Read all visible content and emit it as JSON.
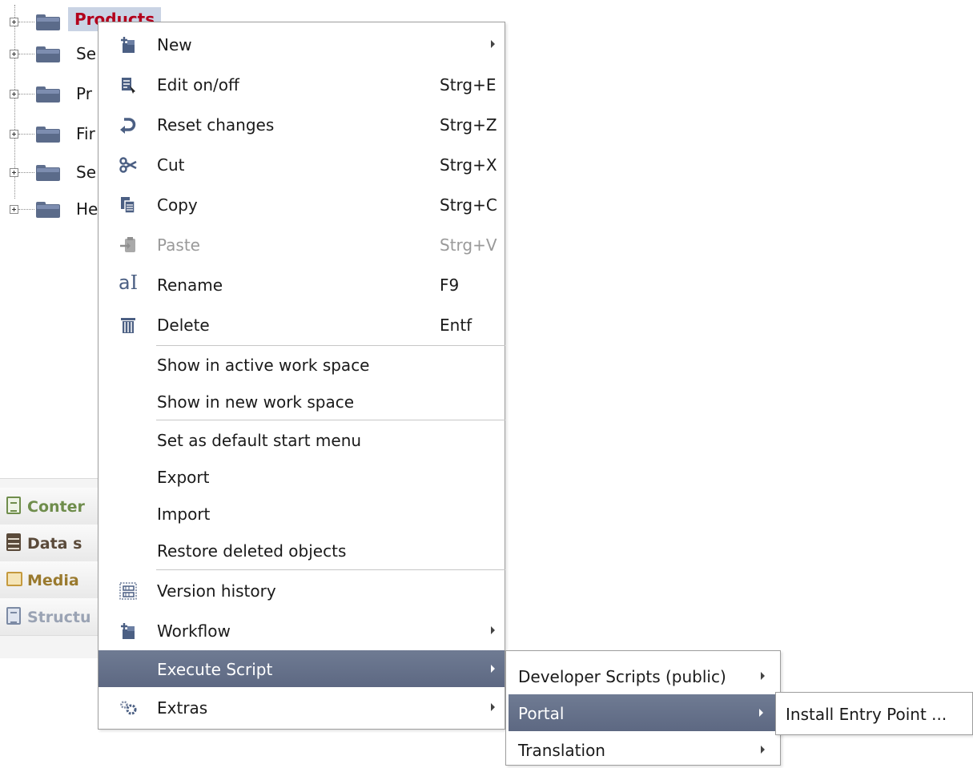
{
  "tree": {
    "items": [
      {
        "label": "Products",
        "selected": true
      },
      {
        "label": "Se"
      },
      {
        "label": "Pr"
      },
      {
        "label": "Fir"
      },
      {
        "label": "Se"
      },
      {
        "label": "He"
      }
    ]
  },
  "nav": {
    "items": [
      {
        "label": "Conter",
        "icon": "content-icon",
        "color": "#6f8d4c"
      },
      {
        "label": "Data s",
        "icon": "data-sources-icon",
        "color": "#5a4a3a"
      },
      {
        "label": "Media",
        "icon": "media-icon",
        "color": "#9a7a2e"
      },
      {
        "label": "Structu",
        "icon": "structure-icon",
        "color": "#9aa3b4"
      }
    ]
  },
  "context_menu": {
    "items": [
      {
        "label": "New",
        "shortcut": "",
        "icon": "new-icon",
        "submenu": true
      },
      {
        "label": "Edit on/off",
        "shortcut": "Strg+E",
        "icon": "edit-icon"
      },
      {
        "label": "Reset changes",
        "shortcut": "Strg+Z",
        "icon": "reset-icon"
      },
      {
        "label": "Cut",
        "shortcut": "Strg+X",
        "icon": "cut-icon"
      },
      {
        "label": "Copy",
        "shortcut": "Strg+C",
        "icon": "copy-icon"
      },
      {
        "label": "Paste",
        "shortcut": "Strg+V",
        "icon": "paste-icon",
        "disabled": true
      },
      {
        "label": "Rename",
        "shortcut": "F9",
        "icon": "rename-icon"
      },
      {
        "label": "Delete",
        "shortcut": "Entf",
        "icon": "delete-icon"
      },
      {
        "label": "Show in active work space"
      },
      {
        "label": "Show in new work space"
      },
      {
        "label": "Set as default start menu"
      },
      {
        "label": "Export"
      },
      {
        "label": "Import"
      },
      {
        "label": "Restore deleted objects"
      },
      {
        "label": "Version history",
        "icon": "version-history-icon"
      },
      {
        "label": "Workflow",
        "icon": "workflow-icon",
        "submenu": true
      },
      {
        "label": "Execute Script",
        "submenu": true,
        "active": true
      },
      {
        "label": "Extras",
        "icon": "extras-icon",
        "submenu": true
      }
    ]
  },
  "execute_script_submenu": {
    "items": [
      {
        "label": "Developer Scripts (public)",
        "submenu": true
      },
      {
        "label": "Portal",
        "submenu": true,
        "active": true
      },
      {
        "label": "Translation",
        "submenu": true
      }
    ]
  },
  "portal_submenu": {
    "items": [
      {
        "label": "Install Entry Point ..."
      }
    ]
  },
  "colors": {
    "highlight": "#636f88",
    "selected_tree_text": "#b3001b",
    "selected_tree_bg": "#c9d3e4",
    "icon_blue": "#4b5f83"
  }
}
